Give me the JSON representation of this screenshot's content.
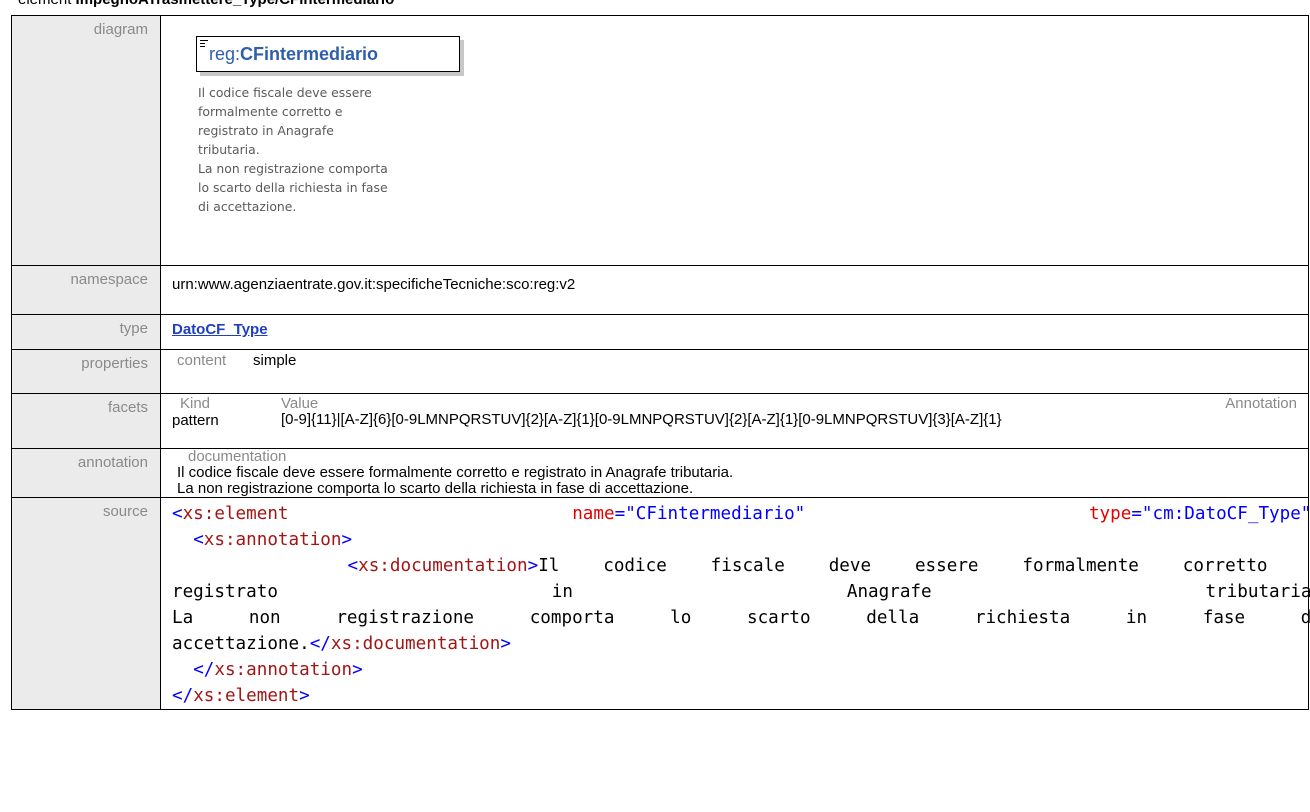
{
  "heading": {
    "prefix": "element ",
    "name": "ImpegnoATrasmettere_Type/CFintermediario"
  },
  "labels": {
    "diagram": "diagram",
    "namespace": "namespace",
    "type": "type",
    "properties": "properties",
    "facets": "facets",
    "annotation": "annotation",
    "source": "source"
  },
  "diagram": {
    "prefix": "reg:",
    "name": "CFintermediario",
    "doc_lines": [
      "Il codice fiscale deve essere",
      "formalmente corretto e",
      "registrato in Anagrafe",
      "tributaria.",
      "La non registrazione comporta",
      "lo scarto della richiesta in fase",
      "di accettazione."
    ]
  },
  "namespace": "urn:www.agenziaentrate.gov.it:specificheTecniche:sco:reg:v2",
  "type": "DatoCF_Type",
  "properties": {
    "key": "content",
    "value": "simple"
  },
  "facets": {
    "head_kind": "Kind",
    "head_value": "Value",
    "head_annotation": "Annotation",
    "kind": "pattern",
    "value": "[0-9]{11}|[A-Z]{6}[0-9LMNPQRSTUV]{2}[A-Z]{1}[0-9LMNPQRSTUV]{2}[A-Z]{1}[0-9LMNPQRSTUV]{3}[A-Z]{1}"
  },
  "annotation": {
    "head": "documentation",
    "lines": [
      "Il codice fiscale deve essere formalmente corretto e registrato in Anagrafe tributaria.",
      "La non registrazione comporta lo scarto della richiesta in fase di accettazione."
    ]
  },
  "source": {
    "el_open": "xs:element",
    "attr_name": "name",
    "val_name": "\"CFintermediario\"",
    "attr_type": "type",
    "val_type": "\"cm:DatoCF_Type\"",
    "ann_tag": "xs:annotation",
    "doc_tag": "xs:documentation",
    "doc_text_1": "Il codice fiscale deve essere formalmente corretto e",
    "doc_text_2": "registrato in Anagrafe tributaria.",
    "doc_text_3": "La non registrazione comporta lo scarto della richiesta in fase di",
    "doc_text_4": "accettazione."
  }
}
